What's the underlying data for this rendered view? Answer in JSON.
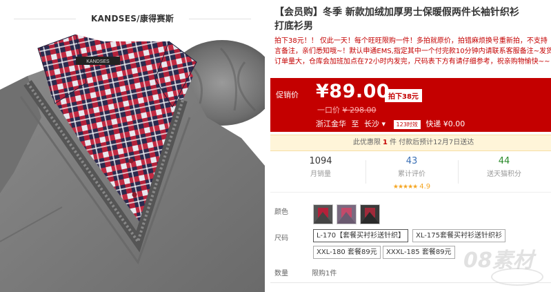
{
  "left": {
    "brand_text": "KANDSES/康得赛斯",
    "collar_label": "KANDSES"
  },
  "product": {
    "title_line1": "【会员购】冬季 新款加绒加厚男士保暖假两件长袖针织衫",
    "title_line2": "打底衫男",
    "desc_line1": "拍下38元！！ 仅此一天！每个旺旺限购一件！多拍就原价，拍错麻烦换号重新拍，不支持",
    "desc_line2": "言备注，亲们悉知哦~！默认申通EMS,指定其中一个付完款10分钟内请联系客服备注~发货",
    "desc_line3": "订单量大，仓库会加班加点在72小时内发完，尺码表下方有请仔细参考，祝亲购物愉快~~"
  },
  "price": {
    "label": "促销价",
    "value": "¥89.00",
    "tag": "拍下38元",
    "orig_label": "一口价",
    "orig_value": "¥ 298.00",
    "ship_from": "浙江金华",
    "ship_to_word": "至",
    "ship_to": "长沙",
    "time_badge": "123时效",
    "express": "快递 ¥0.00"
  },
  "deal": {
    "prefix": "此优惠限",
    "qty": "1",
    "suffix": "件  付款后预计12月7日送达"
  },
  "stats": [
    {
      "num": "1094",
      "label": "月销量",
      "color": "#333333"
    },
    {
      "num": "43",
      "label": "累计评价",
      "color": "#3a6fb5",
      "stars": "★★★★★",
      "rating": "4.9"
    },
    {
      "num": "44",
      "label": "送天猫积分",
      "color": "#2a8a2a"
    }
  ],
  "options": {
    "color_label": "颜色",
    "size_label": "尺码",
    "qty_label": "数量",
    "qty_value": "限购1件",
    "sizes": [
      "L-170【套餐买衬衫送针织】",
      "XL-175套餐买衬衫送针织衫",
      "XXL-180 套餐89元",
      "XXXL-185 套餐89元"
    ]
  },
  "watermark": "08素材"
}
